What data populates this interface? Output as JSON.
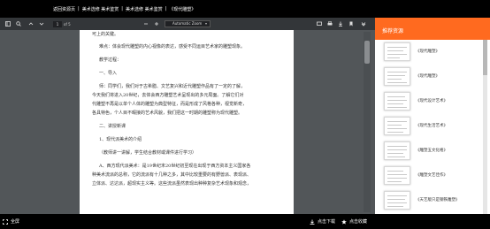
{
  "breadcrumb": [
    "返回资源页",
    "美术选修 美术鉴赏",
    "美术选修 美术鉴赏",
    "《现代雕塑》"
  ],
  "viewer": {
    "page_number": "1",
    "page_total": "of 5",
    "zoom": "Automatic Zoom"
  },
  "document": {
    "lines": [
      "可上的关键。",
      "难点：体会现代雕塑的内心视像的表达，感受不同运目艺术家的雕塑现象。",
      "教学过程：",
      "一、导入",
      "师：同学们，我们对于古希腊、文艺复兴和近代雕塑作品有了一定的了解，",
      "今天我们将进入20世纪，去体会西方雕塑艺术呈现出的多元局面。了解它们对",
      "代雕塑不再是以单个人体的雕塑为典型特征，而是形成了风格各种，视觉新奇，",
      "各具特色，个人目不暇接的艺术风貌，我们把这一时期的雕塑称为现代雕塑。",
      "二、讲授新课",
      "1、现代派美术的介绍",
      "（教师讲一讲解，学生结合教材或课件进行学习）",
      "A、西方现代派美术：是19世纪末20世纪初至现在出现于西方资本主义国家各",
      "种美术流派的总称，它的流派有十几种之多，其中比较重要的有野兽派、表现派、",
      "立体派、达达派，超现实主义等。这些流派虽然表现出种种复杂艺术现象和观念，"
    ]
  },
  "sidebar": {
    "title": "推荐资源",
    "items": [
      "《现代雕塑》",
      "《现代雕塑》",
      "《现代设计艺术》",
      "《现代生活艺术》",
      "《雕塑五文化格》",
      "《雕塑文艺佳作》",
      "《天艺版只是钢铁雕塑》"
    ]
  },
  "bottom": {
    "fullscreen": "全屏",
    "download": "点击下载",
    "favorite": "点击收藏"
  },
  "colors": {
    "accent": "#ff6a1f",
    "viewer_bg": "#525659",
    "toolbar_bg": "#333639"
  }
}
